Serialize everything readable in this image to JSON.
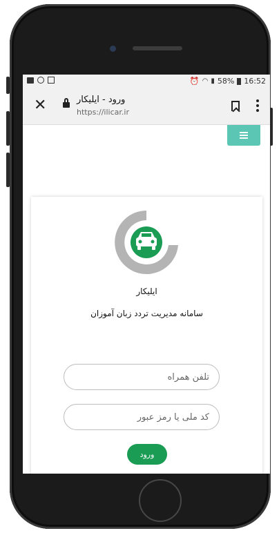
{
  "status_bar": {
    "battery": "58%",
    "time": "16:52"
  },
  "browser": {
    "page_title": "ورود - ایلیکار",
    "url": "https://ilicar.ir"
  },
  "brand": {
    "name": "ایلیکار",
    "subtitle": "سامانه مدیریت تردد زبان آموزان"
  },
  "form": {
    "phone_placeholder": "تلفن همراه",
    "password_placeholder": "کد ملی یا رمز عبور",
    "login_label": "ورود"
  },
  "colors": {
    "accent": "#5ac6b3",
    "primary": "#1a9c55",
    "logo_gray": "#b4b4b4"
  },
  "icons": [
    "notification-icon",
    "wifi-icon",
    "signal-icon",
    "battery-icon",
    "alarm-icon",
    "close-icon",
    "lock-icon",
    "bookmark-icon",
    "kebab-menu-icon",
    "hamburger-icon",
    "car-logo-icon"
  ]
}
